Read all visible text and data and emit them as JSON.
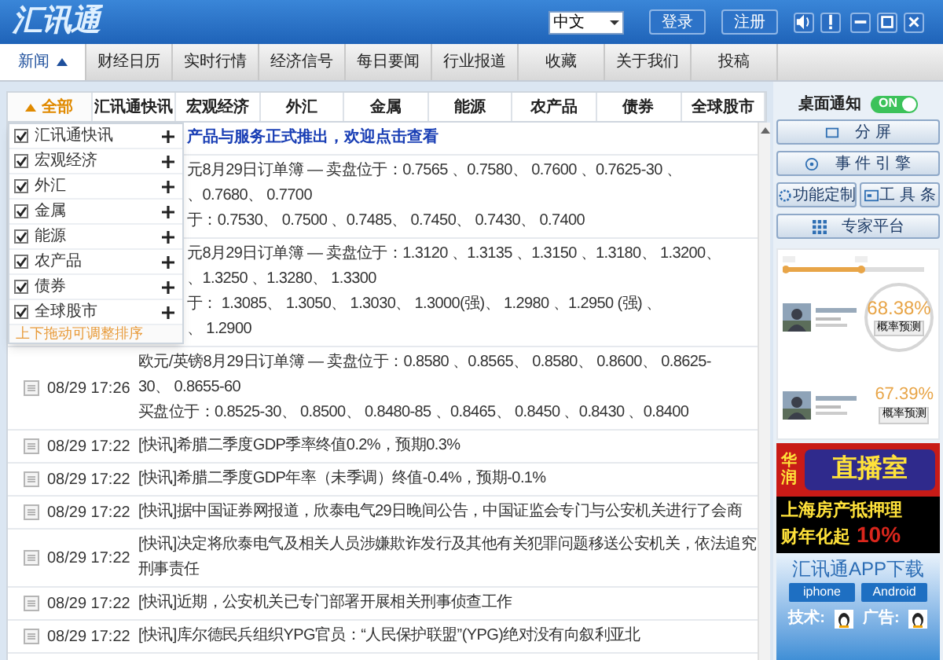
{
  "app": {
    "logo": "汇讯通",
    "language": "中文",
    "buttons": [
      "登录",
      "注册"
    ]
  },
  "tabs": [
    {
      "label": "新闻",
      "selected": true
    },
    {
      "label": "财经日历",
      "selected": false
    },
    {
      "label": "实时行情",
      "selected": false
    },
    {
      "label": "经济信号",
      "selected": false
    },
    {
      "label": "每日要闻",
      "selected": false
    },
    {
      "label": "行业报道",
      "selected": false
    },
    {
      "label": "收藏",
      "selected": false
    },
    {
      "label": "关于我们",
      "selected": false
    },
    {
      "label": "投稿",
      "selected": false
    }
  ],
  "categories": [
    {
      "label": "全部",
      "selected": true
    },
    {
      "label": "汇讯通快讯",
      "selected": false
    },
    {
      "label": "宏观经济",
      "selected": false
    },
    {
      "label": "外汇",
      "selected": false
    },
    {
      "label": "金属",
      "selected": false
    },
    {
      "label": "能源",
      "selected": false
    },
    {
      "label": "农产品",
      "selected": false
    },
    {
      "label": "债券",
      "selected": false
    },
    {
      "label": "全球股市",
      "selected": false
    }
  ],
  "filter_menu": {
    "items": [
      {
        "label": "汇讯通快讯",
        "checked": true
      },
      {
        "label": "宏观经济",
        "checked": true
      },
      {
        "label": "外汇",
        "checked": true
      },
      {
        "label": "金属",
        "checked": true
      },
      {
        "label": "能源",
        "checked": true
      },
      {
        "label": "农产品",
        "checked": true
      },
      {
        "label": "债券",
        "checked": true
      },
      {
        "label": "全球股市",
        "checked": true
      }
    ],
    "hint": "上下拖动可调整排序"
  },
  "news": [
    {
      "kind": "link",
      "lines": [
        "产品与服务正式推出，欢迎点击查看"
      ]
    },
    {
      "kind": "text",
      "lines": [
        "元8月29日订单簿 — 卖盘位于：0.7565 、0.7580、 0.7600 、0.7625-30 、",
        "、0.7680、 0.7700",
        "于：0.7530、 0.7500 、0.7485、 0.7450、 0.7430、 0.7400"
      ]
    },
    {
      "kind": "text",
      "lines": [
        "元8月29日订单簿 — 卖盘位于：1.3120 、1.3135 、1.3150 、1.3180、 1.3200、",
        "、1.3250 、1.3280、 1.3300",
        "于： 1.3085、 1.3050、 1.3030、 1.3000(强)、 1.2980 、1.2950 (强) 、",
        "、 1.2900"
      ]
    },
    {
      "kind": "text",
      "time": "08/29 17:26",
      "lines": [
        "欧元/英镑8月29日订单簿 — 卖盘位于：0.8580 、0.8565、 0.8580、 0.8600、 0.8625-",
        "30、 0.8655-60",
        "买盘位于：0.8525-30、 0.8500、 0.8480-85 、0.8465、 0.8450 、0.8430 、0.8400"
      ]
    },
    {
      "kind": "text",
      "time": "08/29 17:22",
      "lines": [
        "[快讯]希腊二季度GDP季率终值0.2%，预期0.3%"
      ]
    },
    {
      "kind": "text",
      "time": "08/29 17:22",
      "lines": [
        "[快讯]希腊二季度GDP年率（未季调）终值-0.4%，预期-0.1%"
      ]
    },
    {
      "kind": "text",
      "time": "08/29 17:22",
      "lines": [
        "[快讯]据中国证券网报道，欣泰电气29日晚间公告，中国证监会专门与公安机关进行了会商"
      ]
    },
    {
      "kind": "text",
      "time": "08/29 17:22",
      "lines": [
        "[快讯]决定将欣泰电气及相关人员涉嫌欺诈发行及其他有关犯罪问题移送公安机关，依法追究",
        "刑事责任"
      ]
    },
    {
      "kind": "text",
      "time": "08/29 17:22",
      "lines": [
        "[快讯]近期，公安机关已专门部署开展相关刑事侦查工作"
      ]
    },
    {
      "kind": "text",
      "time": "08/29 17:22",
      "lines": [
        "[快讯]库尔德民兵组织YPG官员：“人民保护联盟”(YPG)绝对没有向叙利亚北"
      ]
    }
  ],
  "side": {
    "notification": {
      "label": "桌面通知",
      "on": true,
      "on_text": "ON"
    },
    "buttons": [
      {
        "label": "分 屏",
        "kind": "wide"
      },
      {
        "label": "事 件 引 擎",
        "kind": "wide"
      },
      {
        "label": "功能定制",
        "kind": "half"
      },
      {
        "label": "工 具 条",
        "kind": "half"
      },
      {
        "label": "专家平台",
        "kind": "wide"
      }
    ],
    "widget": {
      "rows": [
        {
          "value": "68.38%",
          "action": "概率预测"
        },
        {
          "value": "67.39%",
          "action": "概率预测"
        }
      ]
    },
    "live_banner": {
      "brand": "华润",
      "title": "直播室"
    },
    "loan_banner": {
      "line_1": "上海房产抵押理",
      "line_2": "财年化起",
      "rate": "10%"
    },
    "app_download": {
      "title": "汇讯通APP下载",
      "buttons": [
        "iphone",
        "Android"
      ],
      "contacts": [
        "技术:",
        "广告:"
      ]
    }
  }
}
